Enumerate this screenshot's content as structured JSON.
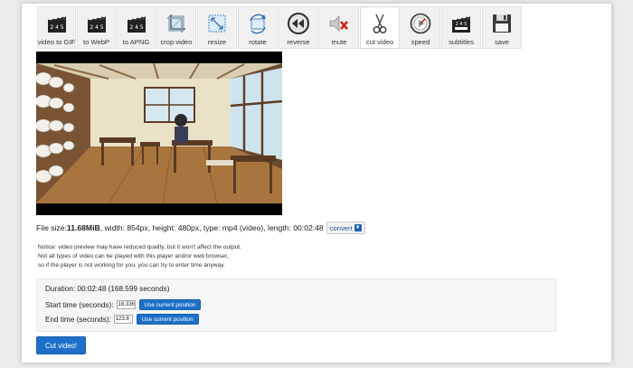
{
  "toolbar": [
    {
      "label": "video to GIF",
      "icon": "clapperboard-gif-icon"
    },
    {
      "label": "to WebP",
      "icon": "clapperboard-webp-icon"
    },
    {
      "label": "to APNG",
      "icon": "clapperboard-apng-icon"
    },
    {
      "label": "crop video",
      "icon": "crop-icon"
    },
    {
      "label": "resize",
      "icon": "resize-icon"
    },
    {
      "label": "rotate",
      "icon": "rotate-icon"
    },
    {
      "label": "reverse",
      "icon": "rewind-icon"
    },
    {
      "label": "mute",
      "icon": "mute-speaker-icon"
    },
    {
      "label": "cut video",
      "icon": "scissors-icon"
    },
    {
      "label": "speed",
      "icon": "speedometer-icon"
    },
    {
      "label": "subtitles",
      "icon": "subtitles-clapperboard-icon"
    },
    {
      "label": "save",
      "icon": "floppy-disk-icon"
    }
  ],
  "active_tool": "cut video",
  "file_info": {
    "prefix": "File size: ",
    "size": "11.68MiB",
    "details": ", width: 854px, height: 480px, type: mp4 (video), length: 00:02:48",
    "convert_label": "convert"
  },
  "notice": {
    "line1": "Notice: video preview may have reduced quality, but it won't affect the output.",
    "line2": "Not all types of video can be played with this player and/or web browser,",
    "line3": "so if the player is not working for you, you can try to enter time anyway."
  },
  "form": {
    "duration_label": "Duration: 00:02:48 (168.599 seconds)",
    "start_label": "Start time (seconds):",
    "start_value": "18.336",
    "end_label": "End time (seconds):",
    "end_value": "123.8",
    "use_current_label": "Use current position"
  },
  "submit_label": "Cut video!",
  "colors": {
    "accent": "#1d6fc7",
    "panel_bg": "#f4f6f7"
  }
}
